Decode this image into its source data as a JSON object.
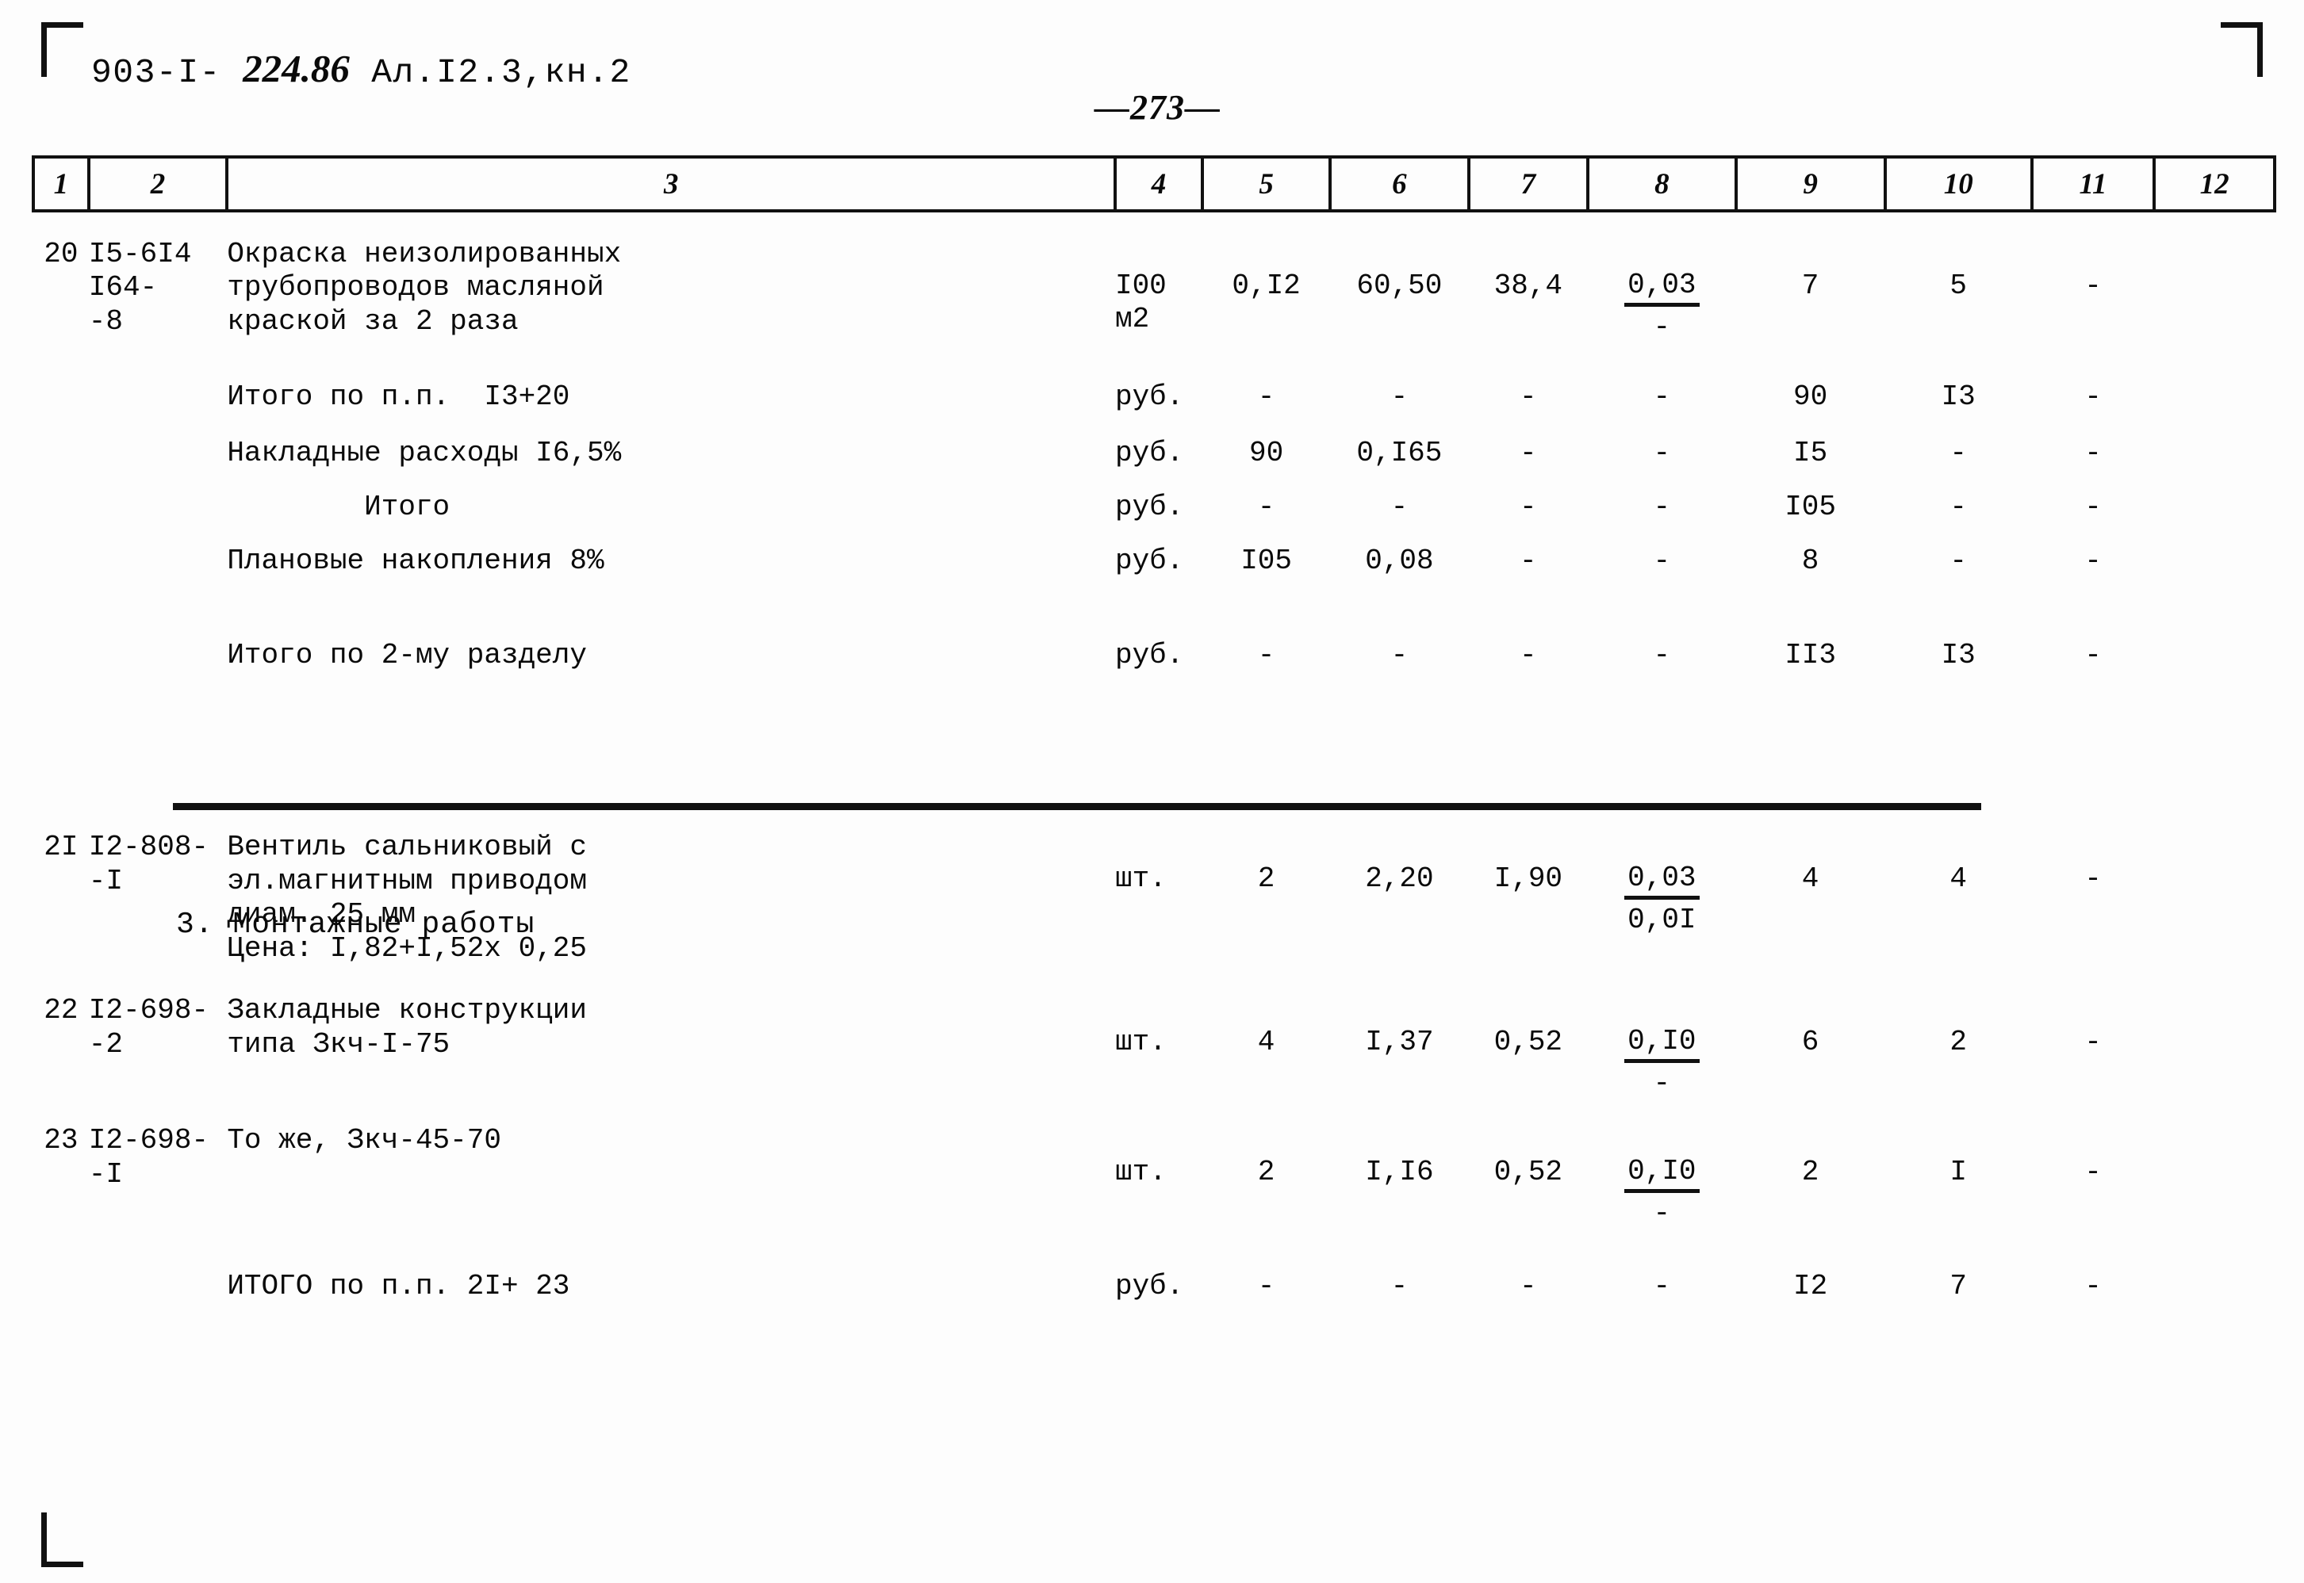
{
  "header": {
    "doc_code_prefix": "903-I- ",
    "doc_code_hand": "224.86",
    "doc_code_suffix": " Ал.I2.3,кн.2",
    "page_number": "—273—"
  },
  "table": {
    "column_numbers": [
      "1",
      "2",
      "3",
      "4",
      "5",
      "6",
      "7",
      "8",
      "9",
      "10",
      "11",
      "12"
    ],
    "rows": [
      {
        "type": "item",
        "num": "20",
        "code_lines": [
          "I5-6I4",
          "I64-",
          "-8"
        ],
        "desc_lines": [
          "Окраска неизолированных",
          "трубопроводов масляной",
          "краской за 2 раза"
        ],
        "unit_lines": [
          "I00",
          "м2"
        ],
        "c5": "0,I2",
        "c6": "60,50",
        "c7": "38,4",
        "c8_top": "0,03",
        "c8_bot": "-",
        "c9": "7",
        "c10": "5",
        "c11": "-",
        "c12": ""
      },
      {
        "type": "total",
        "desc_lines": [
          "Итого по п.п.  I3+20"
        ],
        "unit_lines": [
          "руб."
        ],
        "c5": "-",
        "c6": "-",
        "c7": "-",
        "c8_top": "-",
        "c8_bot": "",
        "c9": "90",
        "c10": "I3",
        "c11": "-",
        "c12": ""
      },
      {
        "type": "total",
        "desc_lines": [
          "Накладные расходы I6,5%"
        ],
        "unit_lines": [
          "руб."
        ],
        "c5": "90",
        "c6": "0,I65",
        "c7": "-",
        "c8_top": "-",
        "c8_bot": "",
        "c9": "I5",
        "c10": "-",
        "c11": "-",
        "c12": ""
      },
      {
        "type": "total",
        "desc_indent": true,
        "desc_lines": [
          "        Итого"
        ],
        "unit_lines": [
          "руб."
        ],
        "c5": "-",
        "c6": "-",
        "c7": "-",
        "c8_top": "-",
        "c8_bot": "",
        "c9": "I05",
        "c10": "-",
        "c11": "-",
        "c12": ""
      },
      {
        "type": "total",
        "desc_lines": [
          "Плановые накопления 8%"
        ],
        "unit_lines": [
          "руб."
        ],
        "c5": "I05",
        "c6": "0,08",
        "c7": "-",
        "c8_top": "-",
        "c8_bot": "",
        "c9": "8",
        "c10": "-",
        "c11": "-",
        "c12": ""
      },
      {
        "type": "grandtotal",
        "desc_lines": [
          "Итого по 2-му разделу"
        ],
        "unit_lines": [
          "руб."
        ],
        "c5": "-",
        "c6": "-",
        "c7": "-",
        "c8_top": "-",
        "c8_bot": "",
        "c9": "II3",
        "c10": "I3",
        "c11": "-",
        "c12": ""
      },
      {
        "type": "item",
        "num": "2I",
        "code_lines": [
          "I2-808-",
          "-I"
        ],
        "desc_lines": [
          "Вентиль сальниковый с",
          "эл.магнитным приводом",
          "диам. 25 мм",
          "Цена: I,82+I,52х 0,25"
        ],
        "unit_lines": [
          "шт."
        ],
        "c5": "2",
        "c6": "2,20",
        "c7": "I,90",
        "c8_top": "0,03",
        "c8_bot": "0,0I",
        "c9": "4",
        "c10": "4",
        "c11": "-",
        "c12": ""
      },
      {
        "type": "item",
        "num": "22",
        "code_lines": [
          "I2-698-",
          "-2"
        ],
        "desc_lines": [
          "Закладные конструкции",
          "типа Зкч-I-75"
        ],
        "unit_lines": [
          "шт."
        ],
        "c5": "4",
        "c6": "I,37",
        "c7": "0,52",
        "c8_top": "0,I0",
        "c8_bot": "-",
        "c9": "6",
        "c10": "2",
        "c11": "-",
        "c12": ""
      },
      {
        "type": "item",
        "num": "23",
        "code_lines": [
          "I2-698-",
          "-I"
        ],
        "desc_lines": [
          "То же, Зкч-45-70"
        ],
        "unit_lines": [
          "шт."
        ],
        "c5": "2",
        "c6": "I,I6",
        "c7": "0,52",
        "c8_top": "0,I0",
        "c8_bot": "-",
        "c9": "2",
        "c10": "I",
        "c11": "-",
        "c12": ""
      },
      {
        "type": "total",
        "desc_lines": [
          "ИТОГО по п.п. 2I+ 23"
        ],
        "unit_lines": [
          "руб."
        ],
        "c5": "-",
        "c6": "-",
        "c7": "-",
        "c8_top": "-",
        "c8_bot": "",
        "c9": "I2",
        "c10": "7",
        "c11": "-",
        "c12": ""
      }
    ]
  },
  "section_heading": "3. Монтажные работы"
}
